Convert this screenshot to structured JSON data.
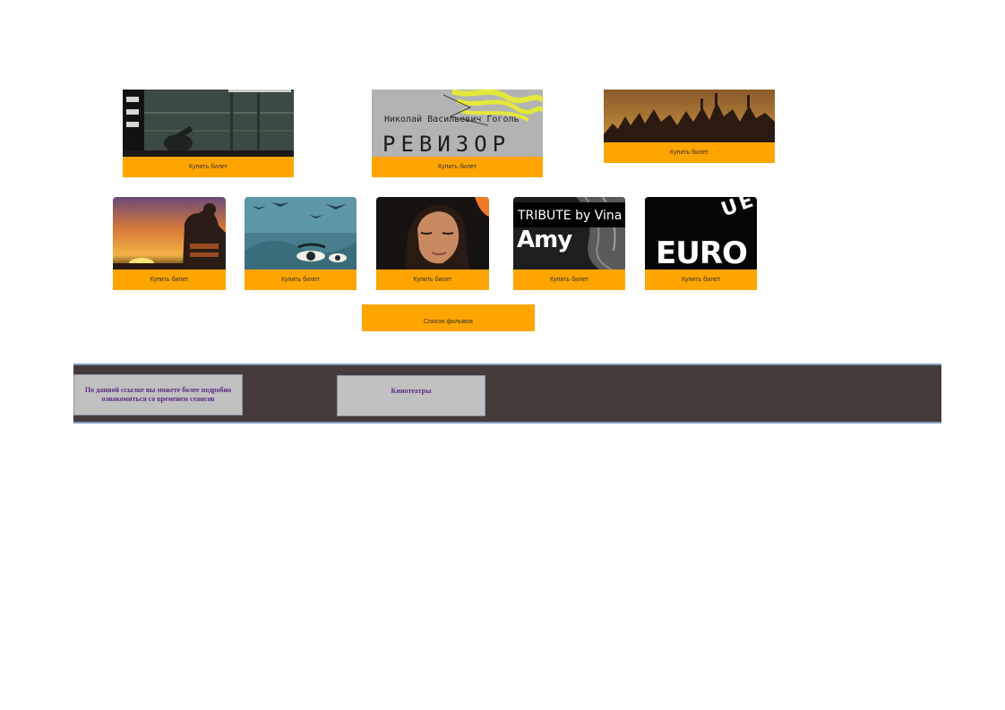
{
  "top_row": [
    {
      "name": "card-war-poster",
      "button_label": "Купить билет"
    },
    {
      "name": "card-revizor",
      "poster_author": "Николай Васильевич Гоголь",
      "poster_title": "РЕВИЗОР",
      "button_label": "Купить билет"
    },
    {
      "name": "card-crowd",
      "button_label": "Купить билет"
    }
  ],
  "bottom_row": [
    {
      "name": "card-sunset",
      "button_label": "Купить билет"
    },
    {
      "name": "card-birds",
      "button_label": "Купить билет"
    },
    {
      "name": "card-woman",
      "button_label": "Купить билет"
    },
    {
      "name": "card-amy",
      "poster_line1": "TRIBUTE by Vina",
      "poster_line2": "Amy",
      "button_label": "Купить билет"
    },
    {
      "name": "card-uefa",
      "poster_arc": "UEFA",
      "poster_title": "EURO",
      "button_label": "Купить билет"
    }
  ],
  "list_button_label": "Список фильмов",
  "footer": {
    "schedule_link": "По данной ссылке вы можете более подробно ознакомиться со временем сеансов",
    "cinemas_link": "Кинотеатры"
  },
  "colors": {
    "button": "#ffa500",
    "footer_bg": "#453b3a",
    "footer_border": "#7f9ac2",
    "footer_box": "#c0c0c0",
    "footer_text": "#5a2a86"
  }
}
